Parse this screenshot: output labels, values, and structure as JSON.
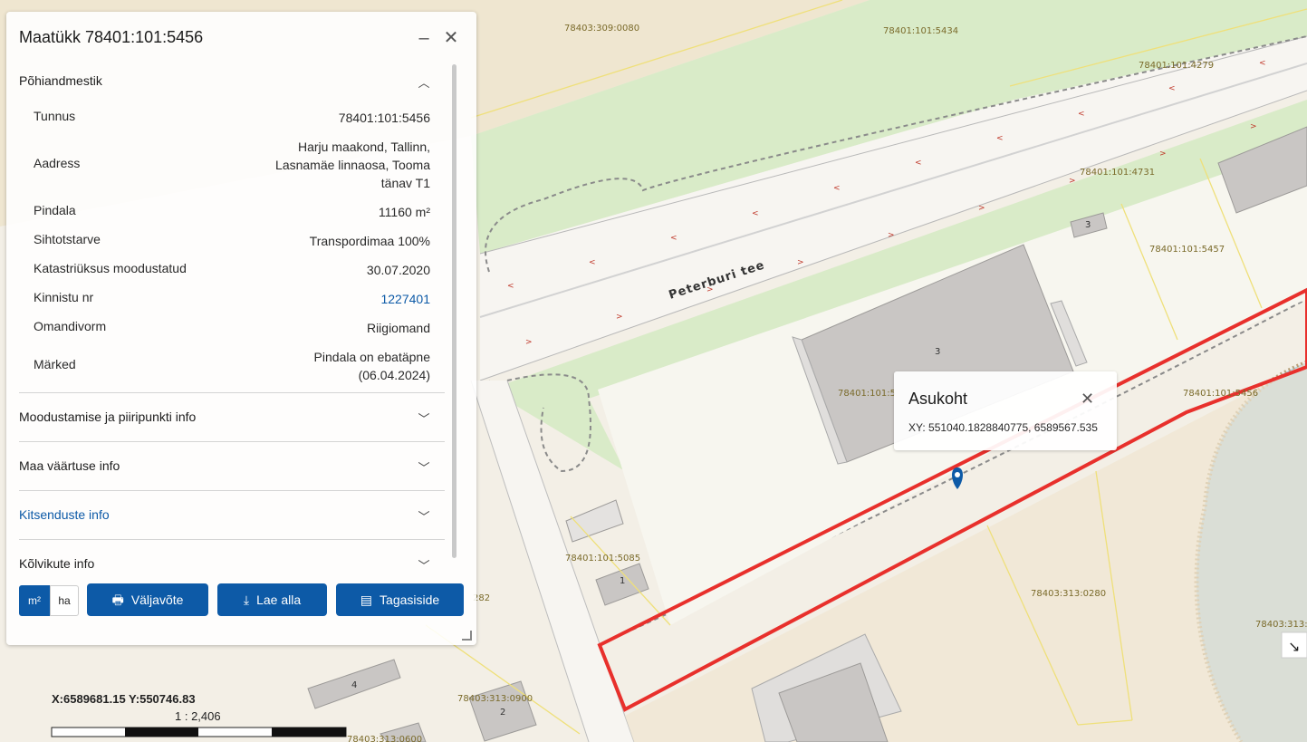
{
  "panel": {
    "title": "Maatükk 78401:101:5456",
    "minimize_icon": "minimize-icon",
    "close_icon": "close-icon",
    "section_main": "Põhiandmestik",
    "rows": [
      {
        "key": "Tunnus",
        "value": "78401:101:5456"
      },
      {
        "key": "Aadress",
        "value_lines": [
          "Harju maakond, Tallinn,",
          "Lasnamäe linnaosa, Tooma",
          "tänav T1"
        ]
      },
      {
        "key": "Pindala",
        "value": "11160 m²"
      },
      {
        "key": "Sihtotstarve",
        "value": "Transpordimaa 100%"
      },
      {
        "key": "Katastriüksus moodustatud",
        "value": "30.07.2020"
      },
      {
        "key": "Kinnistu nr",
        "value": "1227401"
      },
      {
        "key": "Omandivorm",
        "value": "Riigiomand"
      },
      {
        "key": "Märked",
        "value_lines": [
          "Pindala on ebatäpne",
          "(06.04.2024)"
        ]
      }
    ],
    "sections": [
      {
        "label": "Moodustamise ja piiripunkti info"
      },
      {
        "label": "Maa väärtuse info"
      },
      {
        "label": "Kitsenduste info"
      },
      {
        "label": "Kõlvikute info"
      }
    ],
    "unit_m2": "m²",
    "unit_ha": "ha",
    "btn_print": "Väljavõte",
    "btn_download": "Lae alla",
    "btn_feedback": "Tagasiside"
  },
  "popup": {
    "title": "Asukoht",
    "xy": "XY: 551040.1828840775, 6589567.535"
  },
  "map": {
    "road_name": "Peterburi tee",
    "parcel_labels": [
      "78403:309:0080",
      "78401:101:5434",
      "78401:101:4279",
      "78401:101:4731",
      "78401:101:5457",
      "78401:101:5",
      "78401:101:5456",
      "78401:101:5085",
      "78403:313:0280",
      "78403:313:0900",
      "78403:313:",
      "282",
      "78403:313:0600"
    ],
    "building_numbers": [
      "3",
      "3",
      "1",
      "4",
      "2"
    ]
  },
  "footer": {
    "coords": "X:6589681.15 Y:550746.83",
    "scale": "1 : 2,406"
  },
  "colors": {
    "accent": "#0d5aa7",
    "parcel_highlight": "#e8302c",
    "water": "#a9cde4"
  }
}
